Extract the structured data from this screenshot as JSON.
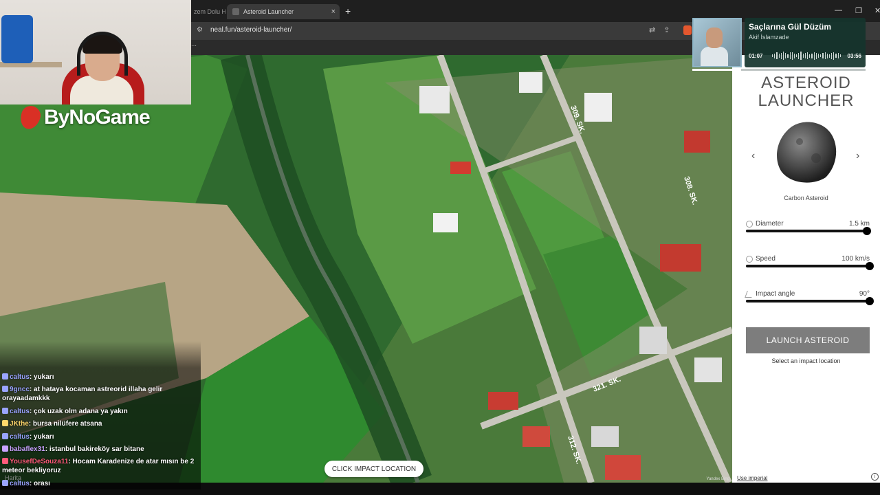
{
  "browser": {
    "prev_tab_title": "zem Dolu H",
    "active_tab_title": "Asteroid Launcher",
    "url": "neal.fun/asteroid-launcher/",
    "new_tab_label": "+",
    "tab_close_label": "×"
  },
  "map": {
    "streets": [
      "309. SK.",
      "308. SK.",
      "321. SK.",
      "312. SK."
    ],
    "click_prompt": "CLICK IMPACT LOCATION",
    "attribution": "Yandex Bing"
  },
  "panel": {
    "title_line1": "ASTEROID",
    "title_line2": "LAUNCHER",
    "asteroid_name": "Carbon Asteroid",
    "prev_icon": "chevron-left-icon",
    "next_icon": "chevron-right-icon",
    "diameter": {
      "label": "Diameter",
      "value": "1.5 km",
      "level": 0.98
    },
    "speed": {
      "label": "Speed",
      "value": "100 km/s",
      "level": 1.0
    },
    "angle": {
      "label": "Impact angle",
      "value": "90°",
      "level": 1.0
    },
    "launch_label": "LAUNCH ASTEROID",
    "hint": "Select an impact location",
    "imperial_link": "Use imperial",
    "info_label": "i"
  },
  "stream": {
    "logo_text": "ByNoGame",
    "chat": [
      {
        "user": "caltus",
        "text": "yukarı",
        "color": "#9aa4ff"
      },
      {
        "user": "9gncc",
        "text": "at hataya kocaman astreorid illaha gelir orayaadamkkk",
        "color": "#9aa4ff"
      },
      {
        "user": "caltus",
        "text": "çok uzak olm adana ya yakın",
        "color": "#9aa4ff"
      },
      {
        "user": "JKthe",
        "text": "bursa nilüfere atsana",
        "color": "#ffd86b"
      },
      {
        "user": "caltus",
        "text": "yukarı",
        "color": "#9aa4ff"
      },
      {
        "user": "babaflex31",
        "text": "istanbul bakireköy sar bitane",
        "color": "#c9a3ff"
      },
      {
        "user": "YousefDeSouza11",
        "text": "Hocam Karadenize de atar mısın be 2 meteor bekliyoruz",
        "color": "#ff5b7a"
      },
      {
        "user": "caltus",
        "text": "orası",
        "color": "#9aa4ff"
      }
    ],
    "chat_background_text": "Harita",
    "music": {
      "song": "Saçlarına Gül Düzüm",
      "artist": "Akif İslamzade",
      "elapsed": "01:07",
      "duration": "03:56",
      "progress": 0.28
    }
  }
}
